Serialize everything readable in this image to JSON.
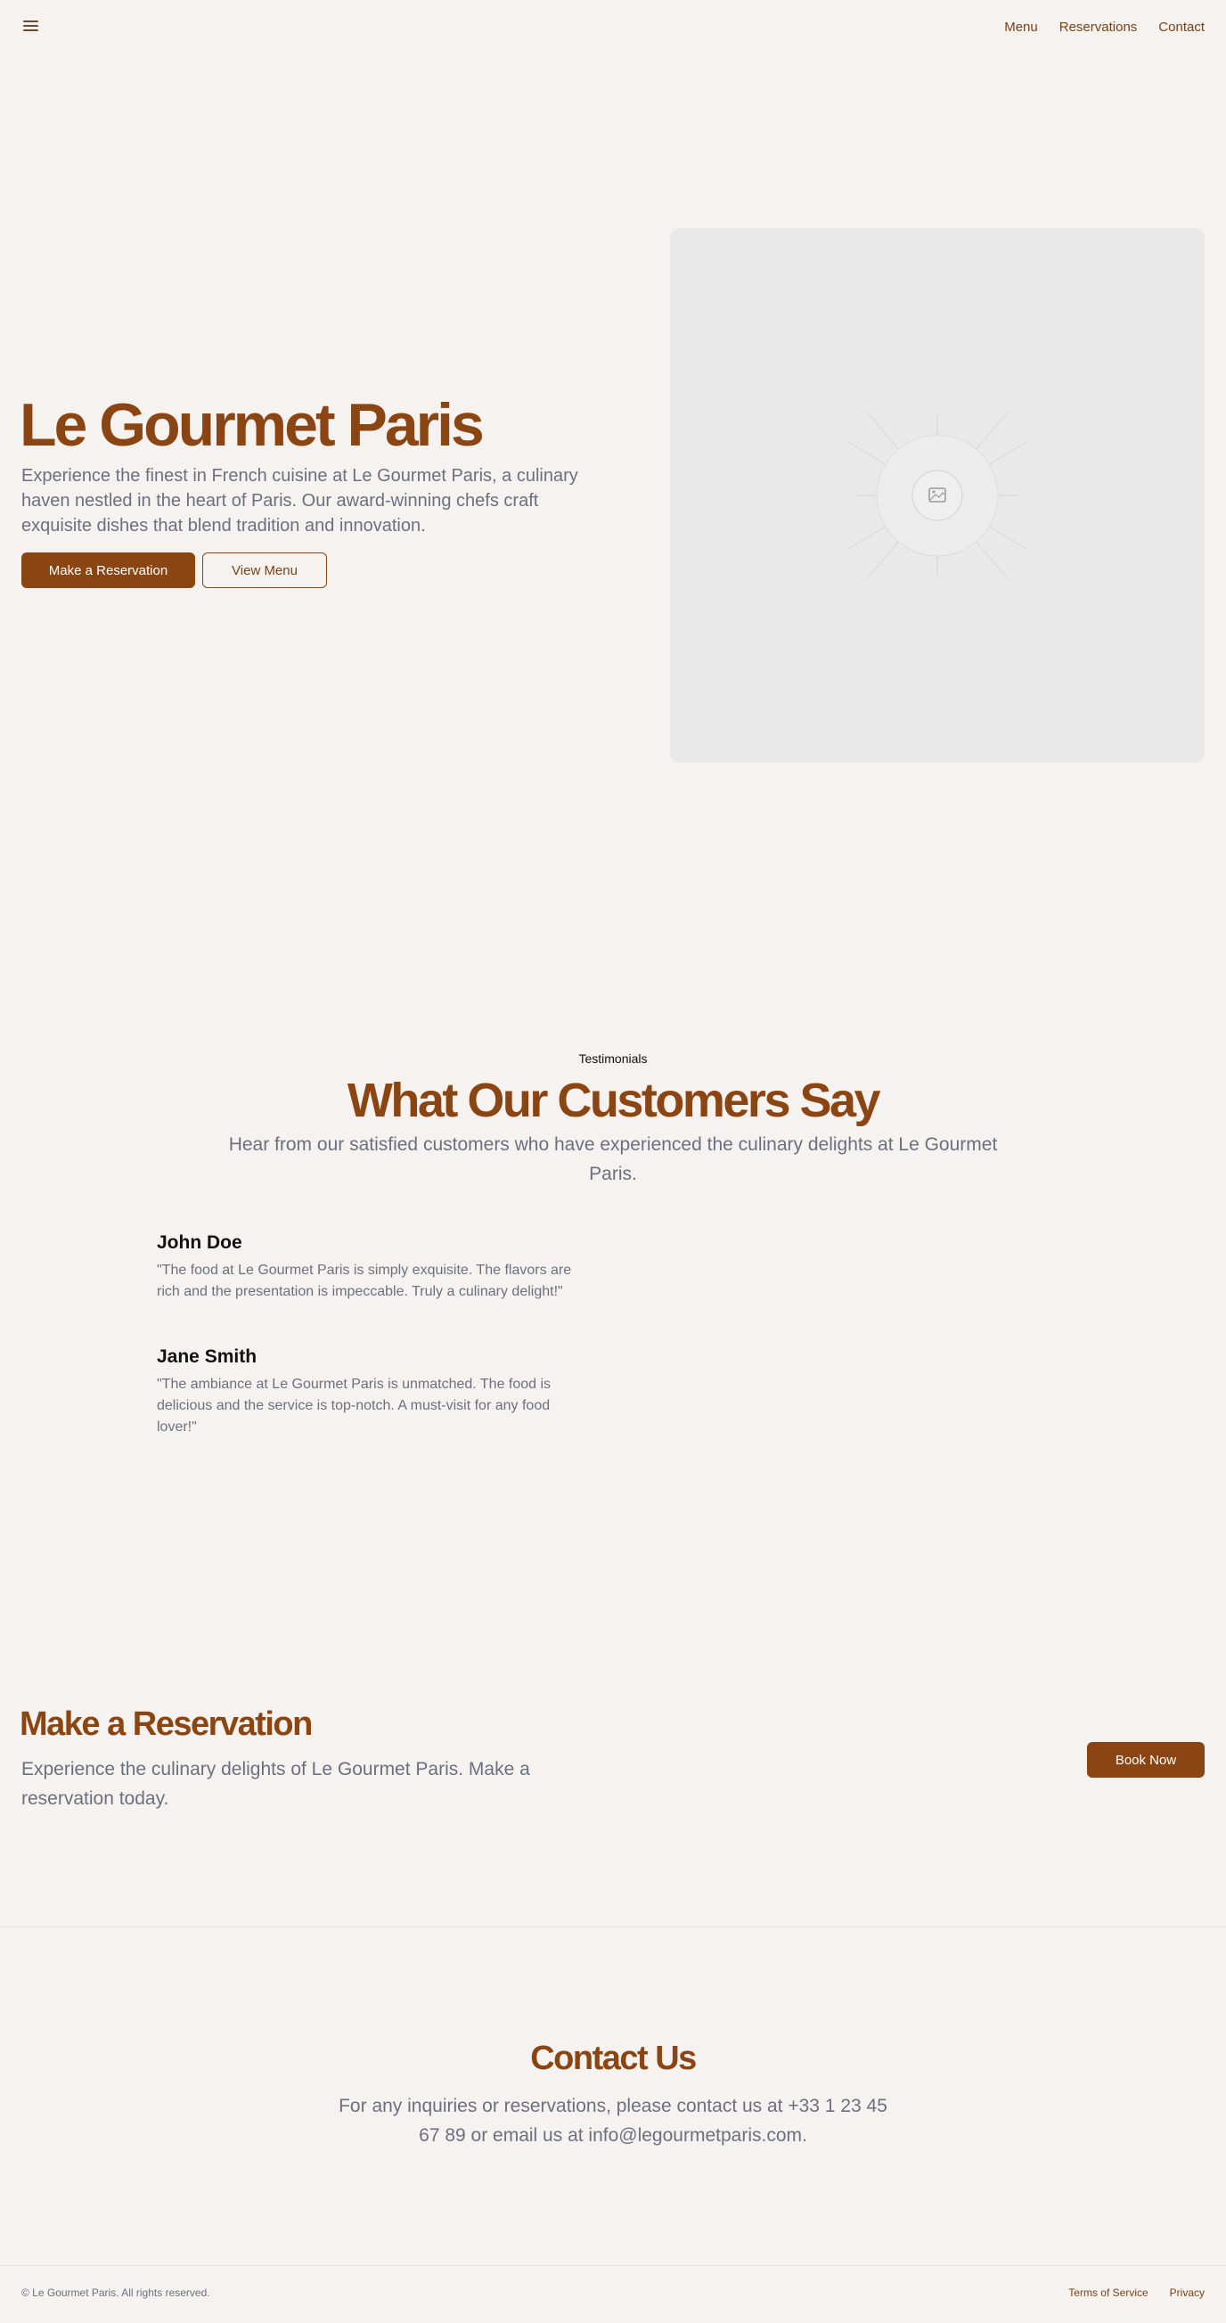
{
  "header": {
    "nav": [
      {
        "label": "Menu"
      },
      {
        "label": "Reservations"
      },
      {
        "label": "Contact"
      }
    ]
  },
  "hero": {
    "title": "Le Gourmet Paris",
    "description": "Experience the finest in French cuisine at Le Gourmet Paris, a culinary haven nestled in the heart of Paris. Our award-winning chefs craft exquisite dishes that blend tradition and innovation.",
    "primary_button": "Make a Reservation",
    "secondary_button": "View Menu",
    "image_icon": "image-placeholder-icon"
  },
  "testimonials": {
    "eyebrow": "Testimonials",
    "title": "What Our Customers Say",
    "subtitle": "Hear from our satisfied customers who have experienced the culinary delights at Le Gourmet Paris.",
    "reviews": [
      {
        "name": "John Doe",
        "text": "\"The food at Le Gourmet Paris is simply exquisite. The flavors are rich and the presentation is impeccable. Truly a culinary delight!\""
      },
      {
        "name": "Jane Smith",
        "text": "\"The ambiance at Le Gourmet Paris is unmatched. The food is delicious and the service is top-notch. A must-visit for any food lover!\""
      }
    ]
  },
  "reservation": {
    "title": "Make a Reservation",
    "description": "Experience the culinary delights of Le Gourmet Paris. Make a reservation today.",
    "button": "Book Now"
  },
  "contact": {
    "title": "Contact Us",
    "text": "For any inquiries or reservations, please contact us at +33 1 23 45 67 89 or email us at info@legourmetparis.com."
  },
  "footer": {
    "copyright": "© Le Gourmet Paris. All rights reserved.",
    "links": [
      {
        "label": "Terms of Service"
      },
      {
        "label": "Privacy"
      }
    ]
  },
  "colors": {
    "accent": "#8b4513",
    "background": "#f6f2ef",
    "muted_text": "#6b7080"
  }
}
